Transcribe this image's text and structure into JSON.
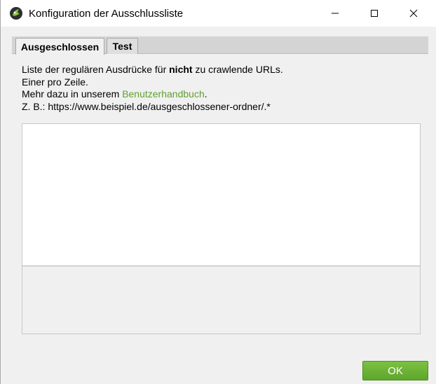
{
  "window": {
    "title": "Konfiguration der Ausschlussliste"
  },
  "tabs": [
    {
      "label": "Ausgeschlossen",
      "active": true
    },
    {
      "label": "Test",
      "active": false
    }
  ],
  "description": {
    "line1_before": "Liste der regulären Ausdrücke für ",
    "line1_bold": "nicht",
    "line1_after": " zu crawlende URLs.",
    "line2": "Einer pro Zeile.",
    "line3_before": "Mehr dazu in unserem ",
    "line3_link": "Benutzerhandbuch",
    "line3_after": ".",
    "line4": "Z. B.: https://www.beispiel.de/ausgeschlossener-ordner/.*"
  },
  "editor": {
    "value": ""
  },
  "footer": {
    "ok_label": "OK"
  },
  "colors": {
    "accent": "#6bb536",
    "link": "#5fa12d"
  }
}
